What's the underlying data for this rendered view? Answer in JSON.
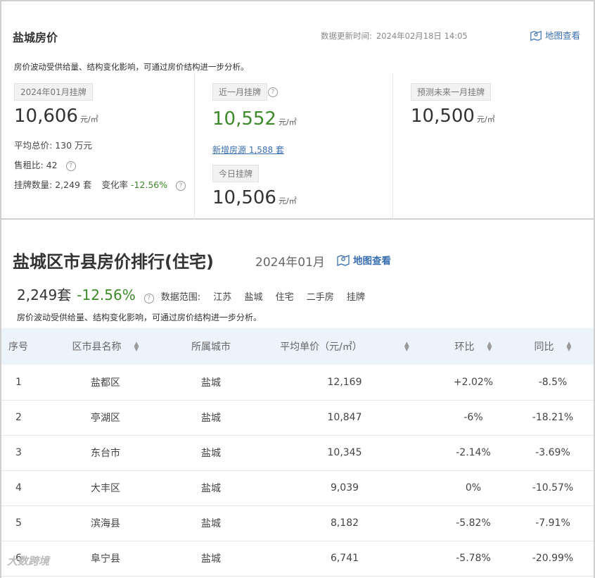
{
  "top": {
    "title": "盐城房价",
    "update_label": "数据更新时间:",
    "update_value": "2024年02月18日 14:05",
    "map_link": "地图查看",
    "description": "房价波动受供给量、结构变化影响，可通过房价结构进一步分析。",
    "col1": {
      "tag": "2024年01月挂牌",
      "price": "10,606",
      "unit": "元/㎡",
      "avg_total_label": "平均总价:",
      "avg_total_value": "130 万元",
      "rent_ratio_label": "售租比:",
      "rent_ratio_value": "42",
      "listing_label": "挂牌数量:",
      "listing_value": "2,249 套",
      "change_label": "变化率",
      "change_value": "-12.56%"
    },
    "col2": {
      "tag": "近一月挂牌",
      "price": "10,552",
      "unit": "元/㎡",
      "new_listing": "新增房源 1,588 套",
      "today_tag": "今日挂牌",
      "today_price": "10,506",
      "today_unit": "元/㎡"
    },
    "col3": {
      "tag": "预测未来一月挂牌",
      "price": "10,500",
      "unit": "元/㎡"
    }
  },
  "bottom": {
    "title": "盐城区市县房价排行(住宅)",
    "month": "2024年01月",
    "map_link": "地图查看",
    "count": "2,249套",
    "change": "-12.56%",
    "scope_label": "数据范围:",
    "scope_items": [
      "江苏",
      "盐城",
      "住宅",
      "二手房",
      "挂牌"
    ],
    "description": "房价波动受供给量、结构变化影响，可通过房价结构进一步分析。",
    "headers": [
      "序号",
      "区市县名称",
      "所属城市",
      "平均单价（元/㎡）",
      "环比",
      "同比"
    ],
    "rows": [
      {
        "no": "1",
        "name": "盐都区",
        "city": "盐城",
        "price": "12,169",
        "mom": "+2.02%",
        "yoy": "-8.5%"
      },
      {
        "no": "2",
        "name": "亭湖区",
        "city": "盐城",
        "price": "10,847",
        "mom": "-6%",
        "yoy": "-18.21%"
      },
      {
        "no": "3",
        "name": "东台市",
        "city": "盐城",
        "price": "10,345",
        "mom": "-2.14%",
        "yoy": "-3.69%"
      },
      {
        "no": "4",
        "name": "大丰区",
        "city": "盐城",
        "price": "9,039",
        "mom": "0%",
        "yoy": "-10.57%"
      },
      {
        "no": "5",
        "name": "滨海县",
        "city": "盐城",
        "price": "8,182",
        "mom": "-5.82%",
        "yoy": "-7.91%"
      },
      {
        "no": "6",
        "name": "阜宁县",
        "city": "盐城",
        "price": "6,741",
        "mom": "-5.78%",
        "yoy": "-20.99%"
      }
    ],
    "watermark": "大数跨境"
  },
  "colors": {
    "up": "#c4262d",
    "down": "#3c8a2a",
    "link": "#3a6fb0"
  }
}
